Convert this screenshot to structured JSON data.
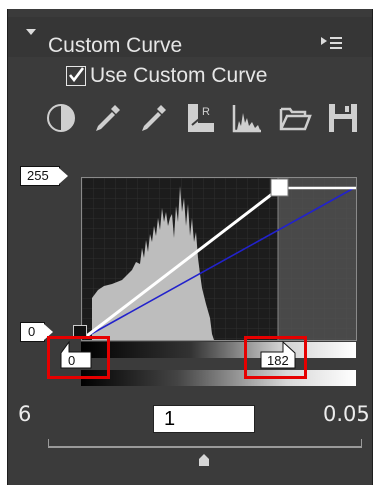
{
  "panel": {
    "title": "Custom Curve",
    "use_custom_curve_label": "Use Custom Curve",
    "use_custom_curve_checked": true
  },
  "toolbar": {
    "icons": [
      "contrast-icon",
      "black-point-eyedropper-icon",
      "white-point-eyedropper-icon",
      "channel-rgb-icon",
      "histogram-icon",
      "open-folder-icon",
      "save-icon"
    ]
  },
  "curve": {
    "output_max_label": "255",
    "output_min_label": "0",
    "input_black_point": "0",
    "input_white_point": "182"
  },
  "gamma": {
    "left_label": "6",
    "value": "1",
    "right_label": "0.05",
    "slider_position": 0.5
  },
  "colors": {
    "panel_bg": "#3b3b3b",
    "curve_line": "#ffffff",
    "reference_line": "#2222cc",
    "highlight_box": "#e60000"
  }
}
